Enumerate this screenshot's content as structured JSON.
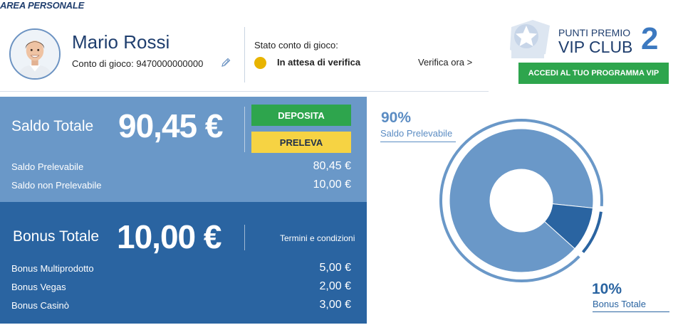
{
  "page": {
    "title": "AREA PERSONALE"
  },
  "user": {
    "name": "Mario Rossi",
    "account_label": "Conto di gioco:",
    "account_number": "9470000000000"
  },
  "status": {
    "label": "Stato conto di gioco:",
    "value": "In attesa di verifica",
    "color": "#e8b400",
    "verify_link": "Verifica ora >"
  },
  "vip": {
    "points_label": "PUNTI PREMIO",
    "club_label": "VIP CLUB",
    "points": "2",
    "button_label": "ACCEDI AL TUO PROGRAMMA VIP"
  },
  "saldo": {
    "title": "Saldo Totale",
    "amount": "90,45 €",
    "deposit_label": "DEPOSITA",
    "withdraw_label": "PRELEVA",
    "rows": [
      {
        "label": "Saldo Prelevabile",
        "value": "80,45 €"
      },
      {
        "label": "Saldo non Prelevabile",
        "value": "10,00 €"
      }
    ]
  },
  "bonus": {
    "title": "Bonus Totale",
    "amount": "10,00 €",
    "terms_label": "Termini e condizioni",
    "rows": [
      {
        "label": "Bonus Multiprodotto",
        "value": "5,00 €"
      },
      {
        "label": "Bonus Vegas",
        "value": "2,00 €"
      },
      {
        "label": "Bonus Casinò",
        "value": "3,00 €"
      }
    ]
  },
  "chart": {
    "segments": [
      {
        "name": "Saldo Prelevabile",
        "percent_label": "90%",
        "value": 90,
        "color": "#6a98c8"
      },
      {
        "name": "Bonus Totale",
        "percent_label": "10%",
        "value": 10,
        "color": "#2a64a1"
      }
    ]
  },
  "colors": {
    "saldo_panel": "#6a98c8",
    "bonus_panel": "#2a64a1",
    "green": "#2ea54d",
    "yellow": "#f6d343"
  }
}
